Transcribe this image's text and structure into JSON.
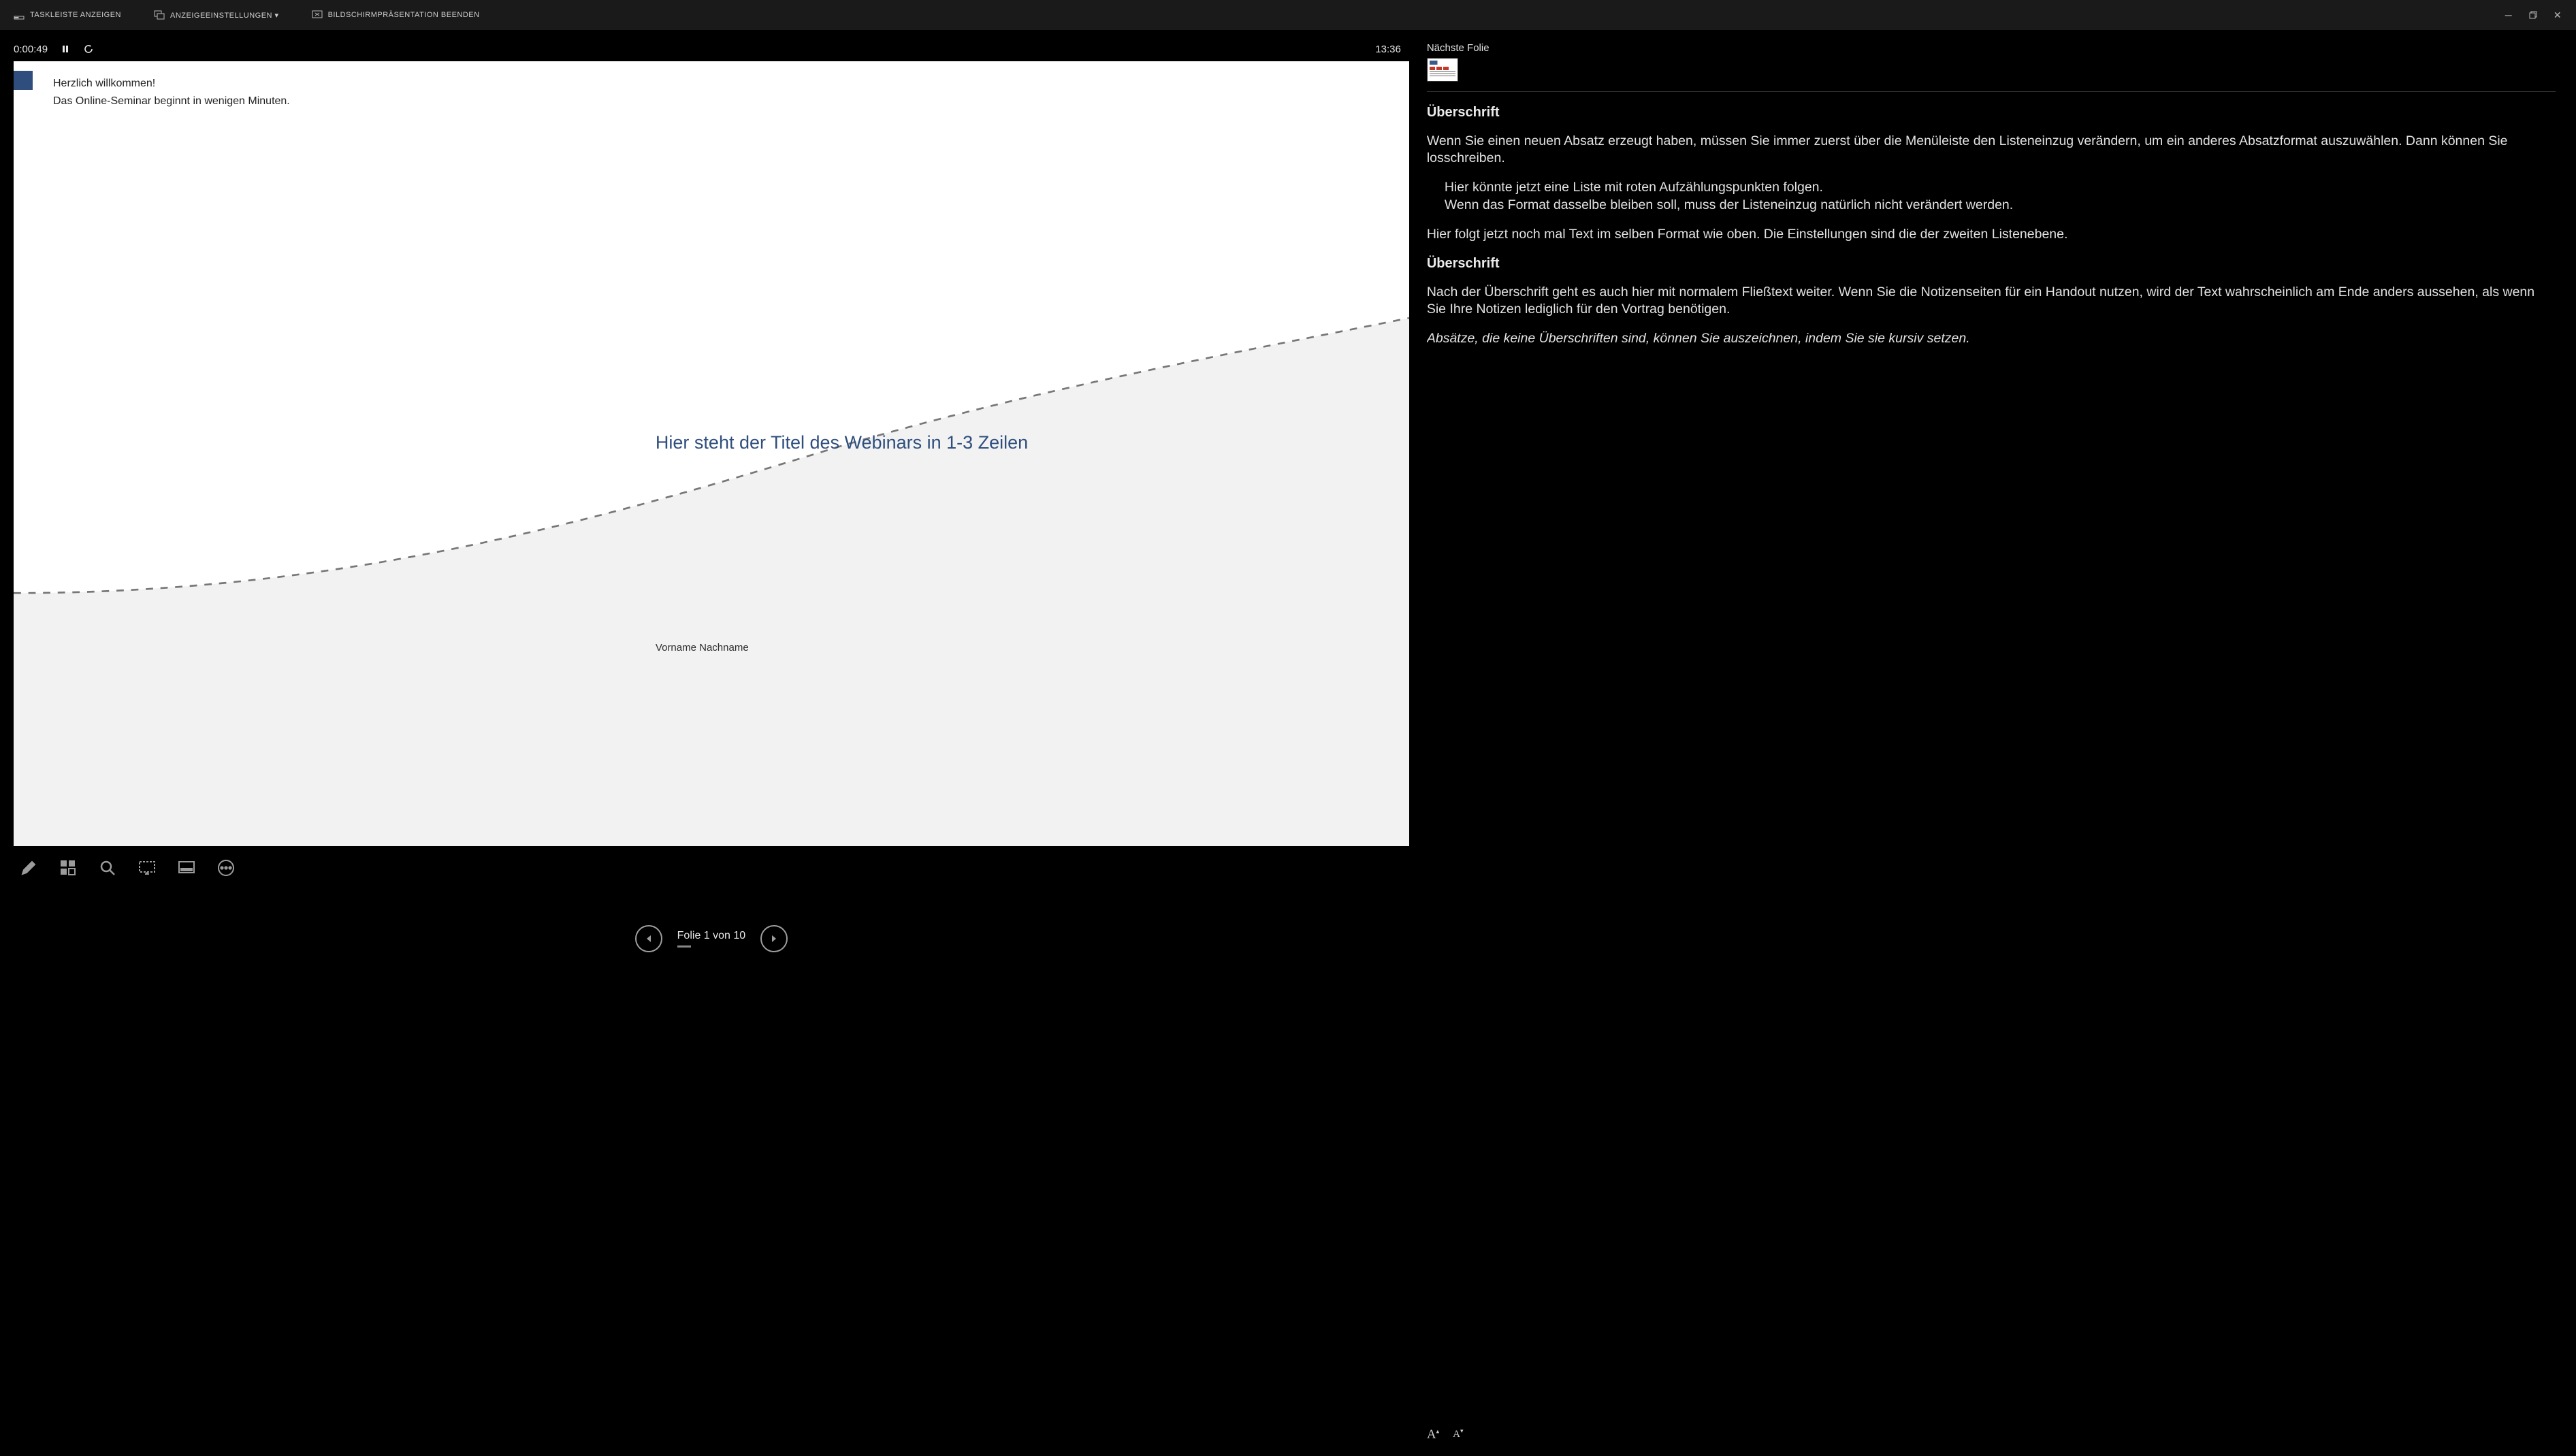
{
  "topbar": {
    "taskbar_label": "TASKLEISTE ANZEIGEN",
    "display_settings_label": "ANZEIGEEINSTELLUNGEN ▾",
    "end_show_label": "BILDSCHIRMPRÄSENTATION BEENDEN"
  },
  "timer": {
    "elapsed": "0:00:49",
    "clock": "13:36"
  },
  "slide": {
    "welcome_line1": "Herzlich willkommen!",
    "welcome_line2": "Das Online-Seminar beginnt in wenigen Minuten.",
    "title": "Hier steht der Titel des Webinars in 1-3 Zeilen",
    "author": "Vorname Nachname"
  },
  "nav": {
    "counter": "Folie 1 von 10"
  },
  "next_slide": {
    "label": "Nächste Folie"
  },
  "notes": {
    "heading1": "Überschrift",
    "para1": "Wenn Sie einen neuen Absatz erzeugt haben, müssen Sie immer zuerst über die Menüleiste den Listeneinzug verändern, um ein anderes Absatzformat auszuwählen. Dann können Sie losschreiben.",
    "bullet1": "Hier könnte jetzt eine Liste mit roten Aufzählungspunkten folgen.",
    "bullet2": "Wenn das Format dasselbe bleiben soll, muss der Listeneinzug natürlich nicht verändert werden.",
    "para2": "Hier folgt jetzt noch mal Text im selben Format wie oben. Die Einstellungen sind die der zweiten Listenebene.",
    "heading2": "Überschrift",
    "para3": "Nach der Überschrift geht es auch hier mit normalem Fließtext weiter. Wenn Sie die Notizenseiten für ein Handout nutzen, wird der Text wahrscheinlich am Ende anders aussehen, als wenn Sie Ihre Notizen lediglich für den Vortrag benötigen.",
    "para4_italic": "Absätze, die keine Überschriften sind, können Sie auszeichnen, indem Sie sie kursiv setzen."
  }
}
